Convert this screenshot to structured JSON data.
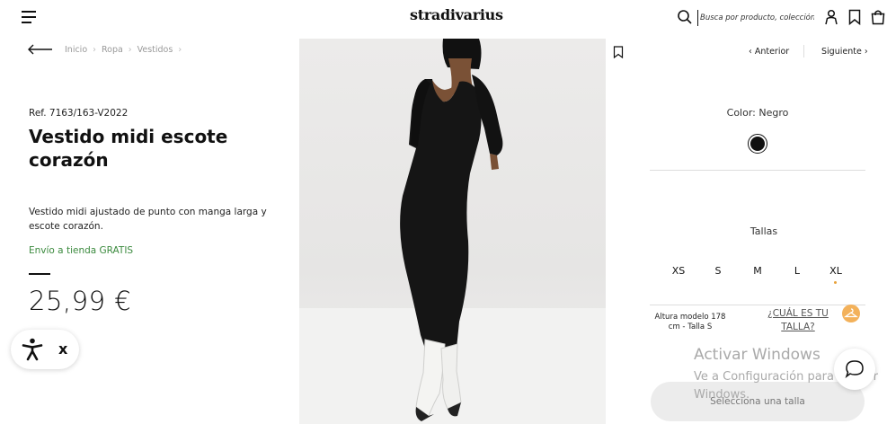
{
  "header": {
    "logo": "stradivarius",
    "search_placeholder": "Busca por producto, colección..."
  },
  "breadcrumb": [
    "Inicio",
    "Ropa",
    "Vestidos"
  ],
  "product": {
    "ref": "Ref. 7163/163-V2022",
    "title": "Vestido midi escote corazón",
    "description": "Vestido midi ajustado de punto con manga larga y escote corazón.",
    "shipping": "Envío a tienda GRATIS",
    "price": "25,99 €"
  },
  "nav": {
    "prev": "Anterior",
    "next": "Siguiente"
  },
  "color": {
    "label": "Color: Negro",
    "swatch": "#111111"
  },
  "sizes": {
    "label": "Tallas",
    "options": [
      "XS",
      "S",
      "M",
      "L",
      "XL"
    ],
    "model_info": "Altura modelo 178 cm - Talla S",
    "size_link": "¿CUÁL ES TU TALLA?"
  },
  "cta": {
    "select_size": "Selecciona una talla"
  },
  "accessibility": {
    "close": "x"
  },
  "watermark": {
    "title": "Activar Windows",
    "subtitle": "Ve a Configuración para activar Windows."
  },
  "colors": {
    "shipping_green": "#3b8a3e",
    "hanger_orange": "#f3b15a",
    "cta_bg": "#ececec"
  }
}
